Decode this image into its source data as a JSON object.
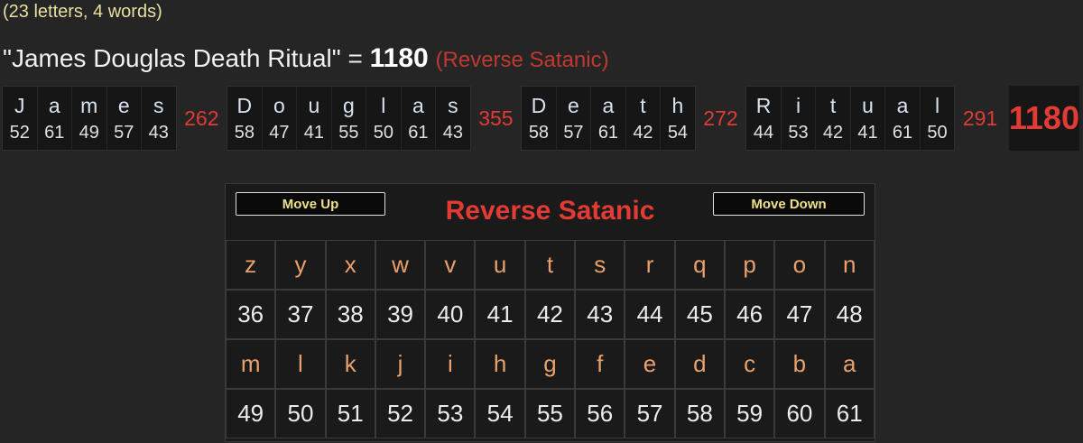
{
  "summary": {
    "count_text": "(23 letters, 4 words)",
    "phrase_text": "\"James Douglas Death Ritual\" = ",
    "total": "1180",
    "cipher_label": "(Reverse Satanic)"
  },
  "breakdown": {
    "words": [
      {
        "letters": [
          "J",
          "a",
          "m",
          "e",
          "s"
        ],
        "values": [
          "52",
          "61",
          "49",
          "57",
          "43"
        ],
        "total": "262"
      },
      {
        "letters": [
          "D",
          "o",
          "u",
          "g",
          "l",
          "a",
          "s"
        ],
        "values": [
          "58",
          "47",
          "41",
          "55",
          "50",
          "61",
          "43"
        ],
        "total": "355"
      },
      {
        "letters": [
          "D",
          "e",
          "a",
          "t",
          "h"
        ],
        "values": [
          "58",
          "57",
          "61",
          "42",
          "54"
        ],
        "total": "272"
      },
      {
        "letters": [
          "R",
          "i",
          "t",
          "u",
          "a",
          "l"
        ],
        "values": [
          "44",
          "53",
          "42",
          "41",
          "61",
          "50"
        ],
        "total": "291"
      }
    ],
    "grand_total": "1180"
  },
  "panel": {
    "move_up_label": "Move Up",
    "move_down_label": "Move Down",
    "title": "Reverse Satanic",
    "rows": [
      {
        "type": "letter",
        "cells": [
          "z",
          "y",
          "x",
          "w",
          "v",
          "u",
          "t",
          "s",
          "r",
          "q",
          "p",
          "o",
          "n"
        ]
      },
      {
        "type": "number",
        "cells": [
          "36",
          "37",
          "38",
          "39",
          "40",
          "41",
          "42",
          "43",
          "44",
          "45",
          "46",
          "47",
          "48"
        ]
      },
      {
        "type": "letter",
        "cells": [
          "m",
          "l",
          "k",
          "j",
          "i",
          "h",
          "g",
          "f",
          "e",
          "d",
          "c",
          "b",
          "a"
        ]
      },
      {
        "type": "number",
        "cells": [
          "49",
          "50",
          "51",
          "52",
          "53",
          "54",
          "55",
          "56",
          "57",
          "58",
          "59",
          "60",
          "61"
        ]
      }
    ]
  },
  "colors": {
    "accent_red": "#e23a34",
    "letter_orange": "#e9a06a",
    "button_text": "#f0e08a"
  }
}
